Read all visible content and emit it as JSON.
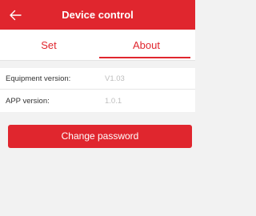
{
  "header": {
    "title": "Device control",
    "back_icon": "arrow-left-icon",
    "background_color": "#e0262e"
  },
  "tabs": [
    {
      "label": "Set",
      "active": false
    },
    {
      "label": "About",
      "active": true
    }
  ],
  "about": {
    "rows": [
      {
        "label": "Equipment version:",
        "value": "V1.03"
      },
      {
        "label": "APP version:",
        "value": "1.0.1"
      }
    ]
  },
  "actions": {
    "change_password_label": "Change password"
  },
  "colors": {
    "accent": "#e0262e",
    "background": "#f2f2f2",
    "value_text": "#bdbdbd"
  }
}
